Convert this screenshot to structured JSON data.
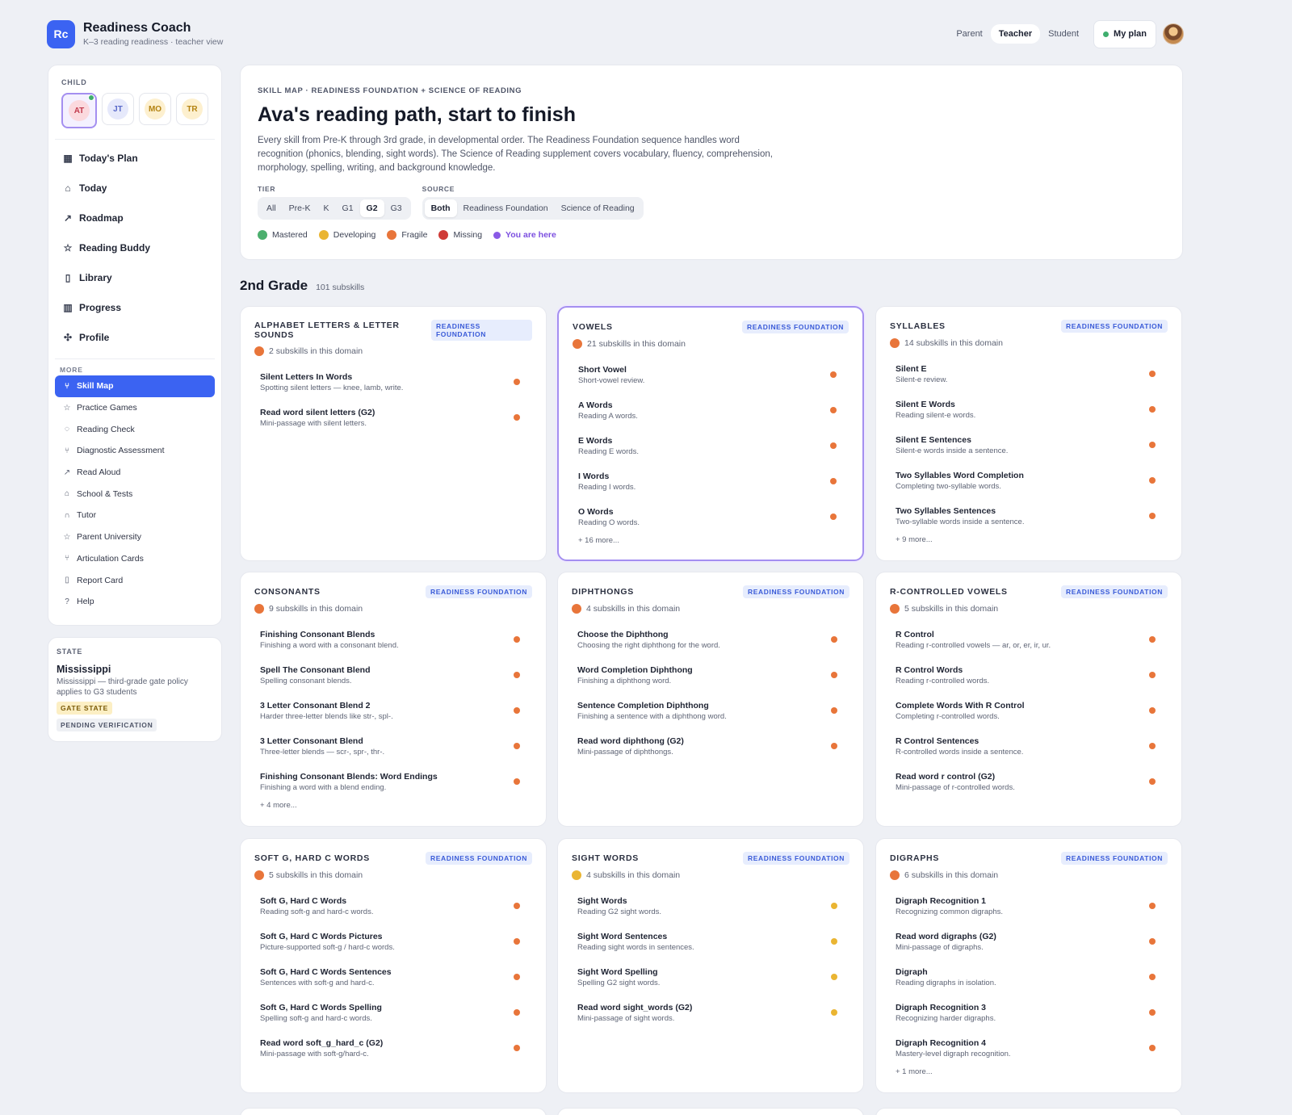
{
  "app": {
    "logo": "Rc",
    "name": "Readiness Coach",
    "subtitle": "K–3 reading readiness · teacher view"
  },
  "topbar": {
    "roles": [
      "Parent",
      "Teacher",
      "Student"
    ],
    "active_role": "Teacher",
    "my_plan": "My plan"
  },
  "sidebar": {
    "child_label": "CHILD",
    "children": [
      {
        "initials": "AT",
        "bg": "#fbd9de",
        "fg": "#c13a4d",
        "selected": true
      },
      {
        "initials": "JT",
        "bg": "#e6e9fb",
        "fg": "#5a6ac9"
      },
      {
        "initials": "MO",
        "bg": "#fdf0cf",
        "fg": "#b48312"
      },
      {
        "initials": "TR",
        "bg": "#fdf0cf",
        "fg": "#b48312"
      }
    ],
    "main_nav": [
      {
        "label": "Today's Plan",
        "icon": "calendar-icon",
        "glyph": "▦"
      },
      {
        "label": "Today",
        "icon": "home-icon",
        "glyph": "⌂"
      },
      {
        "label": "Roadmap",
        "icon": "trend-icon",
        "glyph": "↗"
      },
      {
        "label": "Reading Buddy",
        "icon": "star-icon",
        "glyph": "☆"
      },
      {
        "label": "Library",
        "icon": "document-icon",
        "glyph": "▯"
      },
      {
        "label": "Progress",
        "icon": "bar-chart-icon",
        "glyph": "▥"
      },
      {
        "label": "Profile",
        "icon": "profile-icon",
        "glyph": "✣"
      }
    ],
    "more_label": "MORE",
    "more_nav": [
      {
        "label": "Skill Map",
        "icon": "branch-icon",
        "glyph": "⑂",
        "active": true
      },
      {
        "label": "Practice Games",
        "icon": "star-icon",
        "glyph": "☆"
      },
      {
        "label": "Reading Check",
        "icon": "chat-icon",
        "glyph": "◌"
      },
      {
        "label": "Diagnostic Assessment",
        "icon": "branch-icon",
        "glyph": "⑂"
      },
      {
        "label": "Read Aloud",
        "icon": "trend-icon",
        "glyph": "↗"
      },
      {
        "label": "School & Tests",
        "icon": "school-icon",
        "glyph": "⌂"
      },
      {
        "label": "Tutor",
        "icon": "tutor-icon",
        "glyph": "∩"
      },
      {
        "label": "Parent University",
        "icon": "star-icon",
        "glyph": "☆"
      },
      {
        "label": "Articulation Cards",
        "icon": "branch-icon",
        "glyph": "⑂"
      },
      {
        "label": "Report Card",
        "icon": "document-icon",
        "glyph": "▯"
      },
      {
        "label": "Help",
        "icon": "help-icon",
        "glyph": "?"
      }
    ]
  },
  "state": {
    "label": "STATE",
    "name": "Mississippi",
    "desc": "Mississippi — third-grade gate policy applies to G3 students",
    "gate": "GATE STATE",
    "pending": "PENDING VERIFICATION"
  },
  "header": {
    "eyebrow": "SKILL MAP · READINESS FOUNDATION + SCIENCE OF READING",
    "title": "Ava's reading path, start to finish",
    "desc": "Every skill from Pre-K through 3rd grade, in developmental order. The Readiness Foundation sequence handles word recognition (phonics, blending, sight words). The Science of Reading supplement covers vocabulary, fluency, comprehension, morphology, spelling, writing, and background knowledge.",
    "tier_label": "TIER",
    "tiers": [
      "All",
      "Pre-K",
      "K",
      "G1",
      "G2",
      "G3"
    ],
    "active_tier": "G2",
    "source_label": "SOURCE",
    "sources": [
      "Both",
      "Readiness Foundation",
      "Science of Reading"
    ],
    "active_source": "Both",
    "legend": [
      {
        "label": "Mastered",
        "color": "#4caf6e"
      },
      {
        "label": "Developing",
        "color": "#eab532"
      },
      {
        "label": "Fragile",
        "color": "#e8753a"
      },
      {
        "label": "Missing",
        "color": "#cf3b37"
      },
      {
        "label": "You are here",
        "color": "#8a5ae6"
      }
    ]
  },
  "grade": {
    "title": "2nd Grade",
    "count": "101 subskills"
  },
  "status_colors": {
    "fragile": "#e8753a",
    "developing": "#eab532"
  },
  "domains": [
    {
      "title": "ALPHABET LETTERS & LETTER SOUNDS",
      "badge": "READINESS FOUNDATION",
      "count": "2 subskills in this domain",
      "status": "fragile",
      "skills": [
        {
          "name": "Silent Letters In Words",
          "desc": "Spotting silent letters — knee, lamb, write.",
          "status": "fragile"
        },
        {
          "name": "Read word silent letters (G2)",
          "desc": "Mini-passage with silent letters.",
          "status": "fragile"
        }
      ],
      "more": ""
    },
    {
      "title": "VOWELS",
      "badge": "READINESS FOUNDATION",
      "count": "21 subskills in this domain",
      "status": "fragile",
      "here": true,
      "skills": [
        {
          "name": "Short Vowel",
          "desc": "Short-vowel review.",
          "status": "fragile"
        },
        {
          "name": "A Words",
          "desc": "Reading A words.",
          "status": "fragile"
        },
        {
          "name": "E Words",
          "desc": "Reading E words.",
          "status": "fragile"
        },
        {
          "name": "I Words",
          "desc": "Reading I words.",
          "status": "fragile"
        },
        {
          "name": "O Words",
          "desc": "Reading O words.",
          "status": "fragile"
        }
      ],
      "more": "+ 16 more..."
    },
    {
      "title": "SYLLABLES",
      "badge": "READINESS FOUNDATION",
      "count": "14 subskills in this domain",
      "status": "fragile",
      "skills": [
        {
          "name": "Silent E",
          "desc": "Silent-e review.",
          "status": "fragile"
        },
        {
          "name": "Silent E Words",
          "desc": "Reading silent-e words.",
          "status": "fragile"
        },
        {
          "name": "Silent E Sentences",
          "desc": "Silent-e words inside a sentence.",
          "status": "fragile"
        },
        {
          "name": "Two Syllables Word Completion",
          "desc": "Completing two-syllable words.",
          "status": "fragile"
        },
        {
          "name": "Two Syllables Sentences",
          "desc": "Two-syllable words inside a sentence.",
          "status": "fragile"
        }
      ],
      "more": "+ 9 more..."
    },
    {
      "title": "CONSONANTS",
      "badge": "READINESS FOUNDATION",
      "count": "9 subskills in this domain",
      "status": "fragile",
      "skills": [
        {
          "name": "Finishing Consonant Blends",
          "desc": "Finishing a word with a consonant blend.",
          "status": "fragile"
        },
        {
          "name": "Spell The Consonant Blend",
          "desc": "Spelling consonant blends.",
          "status": "fragile"
        },
        {
          "name": "3 Letter Consonant Blend 2",
          "desc": "Harder three-letter blends like str-, spl-.",
          "status": "fragile"
        },
        {
          "name": "3 Letter Consonant Blend",
          "desc": "Three-letter blends — scr-, spr-, thr-.",
          "status": "fragile"
        },
        {
          "name": "Finishing Consonant Blends: Word Endings",
          "desc": "Finishing a word with a blend ending.",
          "status": "fragile"
        }
      ],
      "more": "+ 4 more..."
    },
    {
      "title": "DIPHTHONGS",
      "badge": "READINESS FOUNDATION",
      "count": "4 subskills in this domain",
      "status": "fragile",
      "skills": [
        {
          "name": "Choose the Diphthong",
          "desc": "Choosing the right diphthong for the word.",
          "status": "fragile"
        },
        {
          "name": "Word Completion Diphthong",
          "desc": "Finishing a diphthong word.",
          "status": "fragile"
        },
        {
          "name": "Sentence Completion Diphthong",
          "desc": "Finishing a sentence with a diphthong word.",
          "status": "fragile"
        },
        {
          "name": "Read word diphthong (G2)",
          "desc": "Mini-passage of diphthongs.",
          "status": "fragile"
        }
      ],
      "more": ""
    },
    {
      "title": "R-CONTROLLED VOWELS",
      "badge": "READINESS FOUNDATION",
      "count": "5 subskills in this domain",
      "status": "fragile",
      "skills": [
        {
          "name": "R Control",
          "desc": "Reading r-controlled vowels — ar, or, er, ir, ur.",
          "status": "fragile"
        },
        {
          "name": "R Control Words",
          "desc": "Reading r-controlled words.",
          "status": "fragile"
        },
        {
          "name": "Complete Words With R Control",
          "desc": "Completing r-controlled words.",
          "status": "fragile"
        },
        {
          "name": "R Control Sentences",
          "desc": "R-controlled words inside a sentence.",
          "status": "fragile"
        },
        {
          "name": "Read word r control (G2)",
          "desc": "Mini-passage of r-controlled words.",
          "status": "fragile"
        }
      ],
      "more": ""
    },
    {
      "title": "SOFT G, HARD C WORDS",
      "badge": "READINESS FOUNDATION",
      "count": "5 subskills in this domain",
      "status": "fragile",
      "skills": [
        {
          "name": "Soft G, Hard C Words",
          "desc": "Reading soft-g and hard-c words.",
          "status": "fragile"
        },
        {
          "name": "Soft G, Hard C Words Pictures",
          "desc": "Picture-supported soft-g / hard-c words.",
          "status": "fragile"
        },
        {
          "name": "Soft G, Hard C Words Sentences",
          "desc": "Sentences with soft-g and hard-c.",
          "status": "fragile"
        },
        {
          "name": "Soft G, Hard C Words Spelling",
          "desc": "Spelling soft-g and hard-c words.",
          "status": "fragile"
        },
        {
          "name": "Read word soft_g_hard_c (G2)",
          "desc": "Mini-passage with soft-g/hard-c.",
          "status": "fragile"
        }
      ],
      "more": ""
    },
    {
      "title": "SIGHT WORDS",
      "badge": "READINESS FOUNDATION",
      "count": "4 subskills in this domain",
      "status": "developing",
      "skills": [
        {
          "name": "Sight Words",
          "desc": "Reading G2 sight words.",
          "status": "developing"
        },
        {
          "name": "Sight Word Sentences",
          "desc": "Reading sight words in sentences.",
          "status": "developing"
        },
        {
          "name": "Sight Word Spelling",
          "desc": "Spelling G2 sight words.",
          "status": "developing"
        },
        {
          "name": "Read word sight_words (G2)",
          "desc": "Mini-passage of sight words.",
          "status": "developing"
        }
      ],
      "more": ""
    },
    {
      "title": "DIGRAPHS",
      "badge": "READINESS FOUNDATION",
      "count": "6 subskills in this domain",
      "status": "fragile",
      "skills": [
        {
          "name": "Digraph Recognition 1",
          "desc": "Recognizing common digraphs.",
          "status": "fragile"
        },
        {
          "name": "Read word digraphs (G2)",
          "desc": "Mini-passage of digraphs.",
          "status": "fragile"
        },
        {
          "name": "Digraph",
          "desc": "Reading digraphs in isolation.",
          "status": "fragile"
        },
        {
          "name": "Digraph Recognition 3",
          "desc": "Recognizing harder digraphs.",
          "status": "fragile"
        },
        {
          "name": "Digraph Recognition 4",
          "desc": "Mastery-level digraph recognition.",
          "status": "fragile"
        }
      ],
      "more": "+ 1 more..."
    }
  ]
}
